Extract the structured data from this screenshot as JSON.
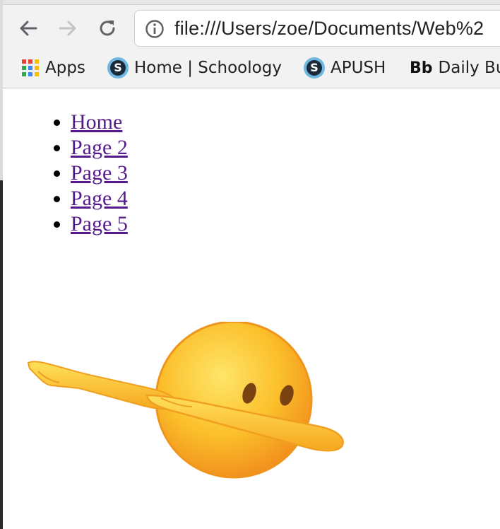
{
  "browser": {
    "back_icon": "arrow-left-icon",
    "forward_icon": "arrow-right-icon",
    "reload_icon": "reload-icon",
    "info_icon": "info-icon",
    "url": "file:///Users/zoe/Documents/Web%2"
  },
  "bookmarks": [
    {
      "label": "Apps",
      "icon": "apps-grid-icon"
    },
    {
      "label": "Home | Schoology",
      "icon": "schoology-icon"
    },
    {
      "label": "APUSH",
      "icon": "schoology-icon"
    },
    {
      "label": "Daily Bu",
      "icon": "bb-icon",
      "icon_text": "Bb"
    }
  ],
  "nav": {
    "links": [
      {
        "label": "Home"
      },
      {
        "label": "Page 2"
      },
      {
        "label": "Page 3"
      },
      {
        "label": "Page 4"
      },
      {
        "label": "Page 5"
      }
    ]
  },
  "image": {
    "icon": "dab-emoji-icon"
  },
  "colors": {
    "link_visited": "#551a8b",
    "emoji_face": "#fbb324",
    "emoji_arm": "#fcc82a"
  }
}
